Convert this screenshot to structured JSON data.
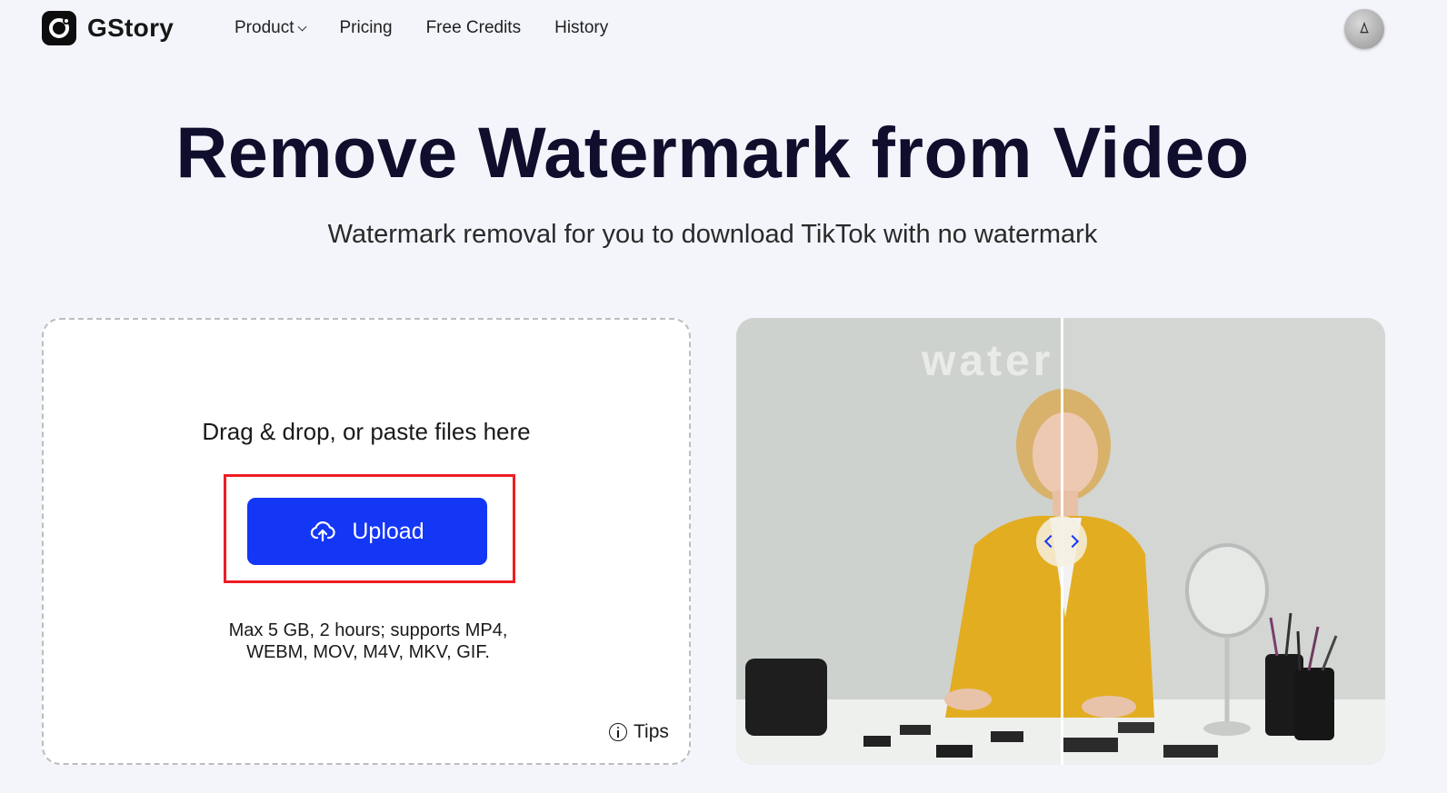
{
  "header": {
    "logo_text": "GStory",
    "nav": [
      {
        "label": "Product",
        "has_dropdown": true
      },
      {
        "label": "Pricing"
      },
      {
        "label": "Free Credits"
      },
      {
        "label": "History"
      }
    ]
  },
  "hero": {
    "title": "Remove Watermark from Video",
    "subtitle": "Watermark removal for you to download TikTok with no watermark"
  },
  "upload": {
    "drop_text": "Drag & drop, or paste files here",
    "button_label": "Upload",
    "limits_line1": "Max 5 GB, 2 hours; supports MP4,",
    "limits_line2": "WEBM, MOV, M4V, MKV, GIF.",
    "tips_label": "Tips"
  },
  "preview": {
    "watermark_text": "water"
  },
  "colors": {
    "accent": "#1436f5",
    "highlight": "#ee1d23",
    "title": "#0f0e2c",
    "background": "#f3f5fb"
  }
}
